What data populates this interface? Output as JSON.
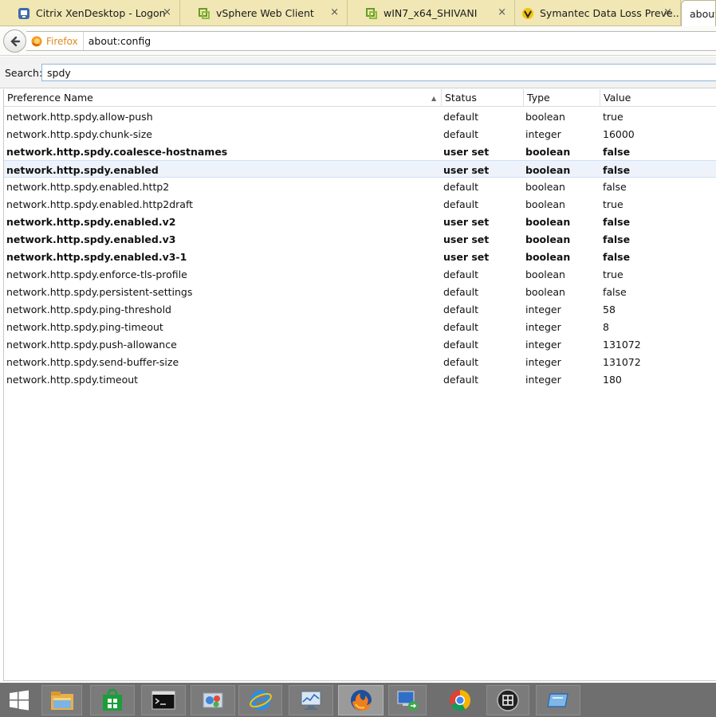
{
  "tabs": [
    {
      "title": "Citrix XenDesktop - Logon",
      "icon": "citrix-icon"
    },
    {
      "title": "vSphere Web Client",
      "icon": "vsphere-icon"
    },
    {
      "title": "wIN7_x64_SHIVANI",
      "icon": "vsphere-icon"
    },
    {
      "title": "Symantec Data Loss Preve...",
      "icon": "symantec-icon"
    },
    {
      "title": "about:",
      "icon": ""
    }
  ],
  "tab_close_glyph": "×",
  "navbar": {
    "identity_label": "Firefox",
    "url": "about:config"
  },
  "search": {
    "label": "Search:",
    "value": "spdy"
  },
  "table": {
    "headers": {
      "name": "Preference Name",
      "status": "Status",
      "type": "Type",
      "value": "Value"
    },
    "sort_glyph": "▲",
    "rows": [
      {
        "name": "network.http.spdy.allow-push",
        "status": "default",
        "type": "boolean",
        "value": "true",
        "bold": false
      },
      {
        "name": "network.http.spdy.chunk-size",
        "status": "default",
        "type": "integer",
        "value": "16000",
        "bold": false
      },
      {
        "name": "network.http.spdy.coalesce-hostnames",
        "status": "user set",
        "type": "boolean",
        "value": "false",
        "bold": true
      },
      {
        "name": "network.http.spdy.enabled",
        "status": "user set",
        "type": "boolean",
        "value": "false",
        "bold": true,
        "selected": true
      },
      {
        "name": "network.http.spdy.enabled.http2",
        "status": "default",
        "type": "boolean",
        "value": "false",
        "bold": false
      },
      {
        "name": "network.http.spdy.enabled.http2draft",
        "status": "default",
        "type": "boolean",
        "value": "true",
        "bold": false
      },
      {
        "name": "network.http.spdy.enabled.v2",
        "status": "user set",
        "type": "boolean",
        "value": "false",
        "bold": true
      },
      {
        "name": "network.http.spdy.enabled.v3",
        "status": "user set",
        "type": "boolean",
        "value": "false",
        "bold": true
      },
      {
        "name": "network.http.spdy.enabled.v3-1",
        "status": "user set",
        "type": "boolean",
        "value": "false",
        "bold": true
      },
      {
        "name": "network.http.spdy.enforce-tls-profile",
        "status": "default",
        "type": "boolean",
        "value": "true",
        "bold": false
      },
      {
        "name": "network.http.spdy.persistent-settings",
        "status": "default",
        "type": "boolean",
        "value": "false",
        "bold": false
      },
      {
        "name": "network.http.spdy.ping-threshold",
        "status": "default",
        "type": "integer",
        "value": "58",
        "bold": false
      },
      {
        "name": "network.http.spdy.ping-timeout",
        "status": "default",
        "type": "integer",
        "value": "8",
        "bold": false
      },
      {
        "name": "network.http.spdy.push-allowance",
        "status": "default",
        "type": "integer",
        "value": "131072",
        "bold": false
      },
      {
        "name": "network.http.spdy.send-buffer-size",
        "status": "default",
        "type": "integer",
        "value": "131072",
        "bold": false
      },
      {
        "name": "network.http.spdy.timeout",
        "status": "default",
        "type": "integer",
        "value": "180",
        "bold": false
      }
    ]
  },
  "taskbar": {
    "items": [
      {
        "icon": "windows-start-icon"
      },
      {
        "icon": "file-explorer-icon"
      },
      {
        "icon": "windows-store-icon"
      },
      {
        "icon": "command-prompt-icon"
      },
      {
        "icon": "control-panel-icon"
      },
      {
        "icon": "internet-explorer-icon"
      },
      {
        "icon": "performance-monitor-icon"
      },
      {
        "icon": "firefox-icon",
        "active": true
      },
      {
        "icon": "remote-desktop-icon"
      },
      {
        "icon": "chrome-icon"
      },
      {
        "icon": "vmware-console-icon"
      },
      {
        "icon": "app-window-icon"
      }
    ]
  },
  "colors": {
    "tabstrip_bg": "#f0e7b4",
    "firefox_orange": "#e08a1e",
    "selected_row_bg": "#eef3fb",
    "taskbar_bg": "#6f6f6f"
  }
}
